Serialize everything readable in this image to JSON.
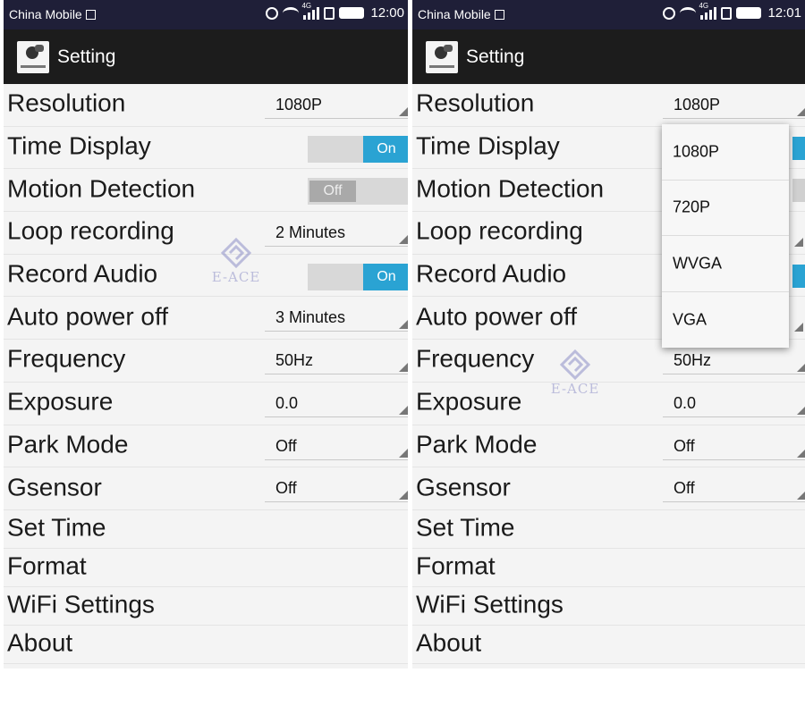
{
  "left": {
    "status": {
      "carrier": "China Mobile",
      "network": "4G",
      "time": "12:00"
    },
    "appbar": {
      "title": "Setting"
    },
    "rows": [
      {
        "label": "Resolution",
        "value": "1080P"
      },
      {
        "label": "Time Display",
        "toggle": "On"
      },
      {
        "label": "Motion Detection",
        "toggle": "Off"
      },
      {
        "label": "Loop recording",
        "value": "2 Minutes"
      },
      {
        "label": "Record Audio",
        "toggle": "On"
      },
      {
        "label": "Auto power off",
        "value": "3 Minutes"
      },
      {
        "label": "Frequency",
        "value": "50Hz"
      },
      {
        "label": "Exposure",
        "value": "0.0"
      },
      {
        "label": "Park Mode",
        "value": "Off"
      },
      {
        "label": "Gsensor",
        "value": "Off"
      },
      {
        "label": "Set Time"
      },
      {
        "label": "Format"
      },
      {
        "label": "WiFi Settings"
      },
      {
        "label": "About"
      }
    ]
  },
  "right": {
    "status": {
      "carrier": "China Mobile",
      "network": "4G",
      "time": "12:01"
    },
    "appbar": {
      "title": "Setting"
    },
    "rows": [
      {
        "label": "Resolution",
        "value": "1080P"
      },
      {
        "label": "Time Display"
      },
      {
        "label": "Motion Detection"
      },
      {
        "label": "Loop recording"
      },
      {
        "label": "Record Audio"
      },
      {
        "label": "Auto power off"
      },
      {
        "label": "Frequency",
        "value": "50Hz"
      },
      {
        "label": "Exposure",
        "value": "0.0"
      },
      {
        "label": "Park Mode",
        "value": "Off"
      },
      {
        "label": "Gsensor",
        "value": "Off"
      },
      {
        "label": "Set Time"
      },
      {
        "label": "Format"
      },
      {
        "label": "WiFi Settings"
      },
      {
        "label": "About"
      }
    ],
    "resolution_popup": {
      "options": [
        "1080P",
        "720P",
        "WVGA",
        "VGA"
      ]
    }
  },
  "watermark": {
    "text": "E-ACE"
  },
  "colors": {
    "statusbar": "#1f1f38",
    "appbar": "#1c1c1c",
    "toggle_on": "#2aa3d3",
    "toggle_off": "#a9a9a9",
    "watermark": "#8d8fc7"
  }
}
